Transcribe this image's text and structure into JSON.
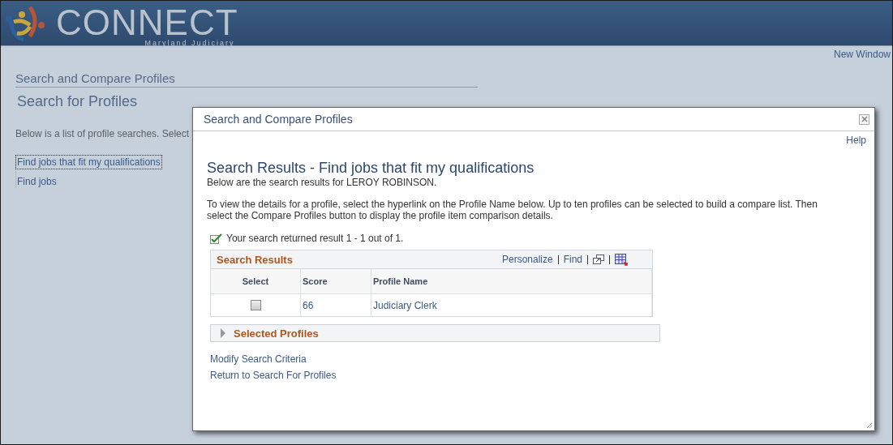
{
  "header": {
    "logo_text": "CONNECT",
    "logo_subtitle": "Maryland Judiciary"
  },
  "new_window": "New Window",
  "page": {
    "breadcrumb": "Search and Compare Profiles",
    "title": "Search for Profiles",
    "intro": "Below is a list of profile searches.  Select",
    "searches": [
      {
        "label": "Find jobs that fit my qualifications",
        "selected": true
      },
      {
        "label": "Find jobs",
        "selected": false
      }
    ]
  },
  "dialog": {
    "title": "Search and Compare Profiles",
    "help": "Help",
    "heading": "Search Results - Find jobs that fit my qualifications",
    "subheading": "Below are the search results for LEROY ROBINSON.",
    "instructions": "To view the details for a profile, select the hyperlink on the Profile Name below. Up to ten profiles can be selected to build a compare list. Then select the Compare Profiles button to display the profile item comparison details.",
    "result_message": "Your search returned result 1 - 1 out of 1.",
    "grid": {
      "title": "Search Results",
      "tools": [
        "Personalize",
        "Find"
      ],
      "columns": [
        "Select",
        "Score",
        "Profile Name"
      ],
      "rows": [
        {
          "checked": false,
          "score": "66",
          "profile_name": "Judiciary Clerk"
        }
      ]
    },
    "selected_profiles": {
      "label": "Selected Profiles",
      "expanded": false
    },
    "links": [
      "Modify Search Criteria",
      "Return to Search For Profiles"
    ]
  }
}
